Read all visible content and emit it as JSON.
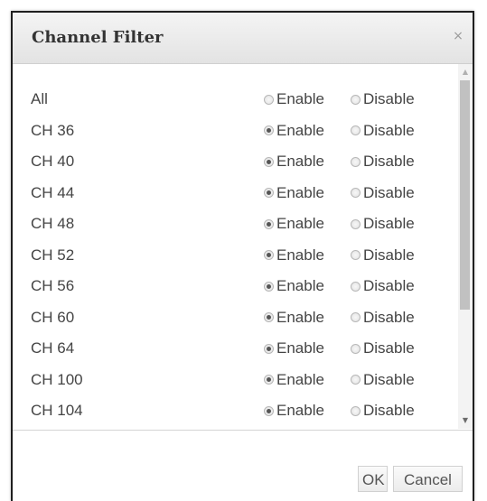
{
  "dialog": {
    "title": "Channel Filter",
    "close_glyph": "×"
  },
  "options": {
    "enable_label": "Enable",
    "disable_label": "Disable"
  },
  "channels": [
    {
      "label": "All",
      "selected": "none"
    },
    {
      "label": "CH 36",
      "selected": "enable"
    },
    {
      "label": "CH 40",
      "selected": "enable"
    },
    {
      "label": "CH 44",
      "selected": "enable"
    },
    {
      "label": "CH 48",
      "selected": "enable"
    },
    {
      "label": "CH 52",
      "selected": "enable"
    },
    {
      "label": "CH 56",
      "selected": "enable"
    },
    {
      "label": "CH 60",
      "selected": "enable"
    },
    {
      "label": "CH 64",
      "selected": "enable"
    },
    {
      "label": "CH 100",
      "selected": "enable"
    },
    {
      "label": "CH 104",
      "selected": "enable"
    }
  ],
  "scrollbar": {
    "up_glyph": "▲",
    "down_glyph": "▼"
  },
  "footer": {
    "ok_label": "OK",
    "cancel_label": "Cancel"
  }
}
